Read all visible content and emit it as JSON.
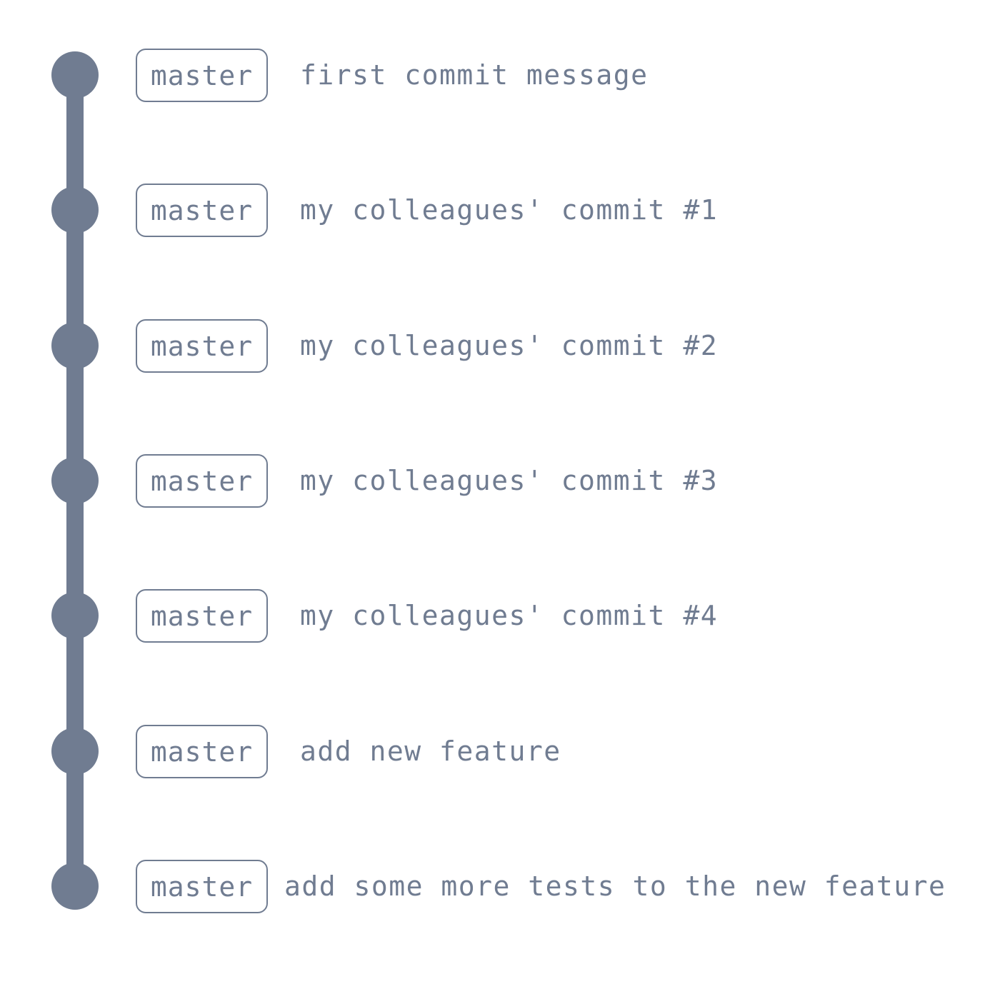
{
  "colors": {
    "graph": "#707c91",
    "background": "#ffffff"
  },
  "commits": [
    {
      "branch": "master",
      "message": "first commit message"
    },
    {
      "branch": "master",
      "message": "my colleagues' commit #1"
    },
    {
      "branch": "master",
      "message": "my colleagues' commit #2"
    },
    {
      "branch": "master",
      "message": "my colleagues' commit #3"
    },
    {
      "branch": "master",
      "message": "my colleagues' commit #4"
    },
    {
      "branch": "master",
      "message": "add new feature"
    },
    {
      "branch": "master",
      "message": "add some more tests to the new feature"
    }
  ]
}
